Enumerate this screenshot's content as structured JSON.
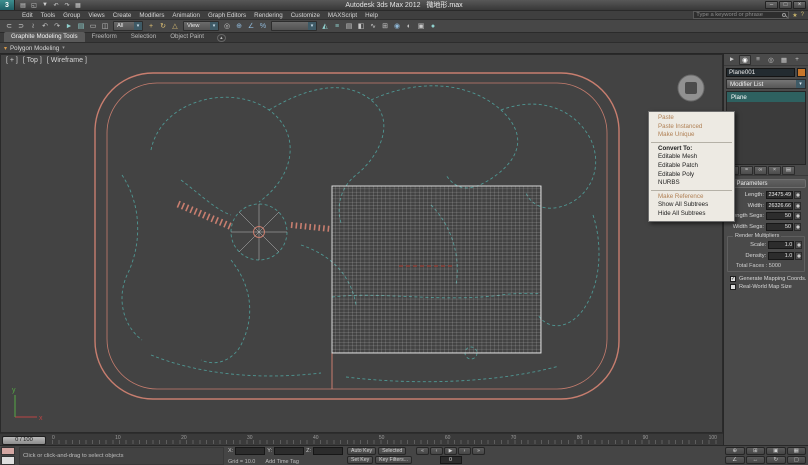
{
  "colors": {
    "salmon": "#c87e6f",
    "teal": "#4f9793",
    "selection": "#2e6160",
    "disabled_item": "#b08055",
    "accent_blue": "#3e5a66",
    "panel": "#4a4a4a"
  },
  "window": {
    "app_title": "Autodesk 3ds Max 2012",
    "doc_title": "微地形.max",
    "minimize": "–",
    "maximize": "□",
    "close": "×"
  },
  "quick_access": [
    {
      "glyph": "▤",
      "name": "new-scene-icon"
    },
    {
      "glyph": "◱",
      "name": "open-file-icon"
    },
    {
      "glyph": "▼",
      "name": "save-file-icon"
    },
    {
      "glyph": "↶",
      "name": "undo-icon"
    },
    {
      "glyph": "↷",
      "name": "redo-icon"
    },
    {
      "glyph": "▦",
      "name": "project-folder-icon"
    }
  ],
  "menubar": {
    "items": [
      {
        "label": "Edit",
        "name": "menu-edit"
      },
      {
        "label": "Tools",
        "name": "menu-tools"
      },
      {
        "label": "Group",
        "name": "menu-group"
      },
      {
        "label": "Views",
        "name": "menu-views"
      },
      {
        "label": "Create",
        "name": "menu-create"
      },
      {
        "label": "Modifiers",
        "name": "menu-modifiers"
      },
      {
        "label": "Animation",
        "name": "menu-animation"
      },
      {
        "label": "Graph Editors",
        "name": "menu-graph-editors"
      },
      {
        "label": "Rendering",
        "name": "menu-rendering"
      },
      {
        "label": "Customize",
        "name": "menu-customize"
      },
      {
        "label": "MAXScript",
        "name": "menu-maxscript"
      },
      {
        "label": "Help",
        "name": "menu-help"
      }
    ],
    "search_placeholder": "Type a keyword or phrase",
    "infocenter_icons": [
      {
        "glyph": "★",
        "name": "favorites-icon"
      },
      {
        "glyph": "?",
        "name": "help-icon"
      }
    ]
  },
  "toolbar": {
    "g1": [
      {
        "glyph": "⊂",
        "tone": "gray",
        "name": "select-and-link-icon"
      },
      {
        "glyph": "⊃",
        "tone": "gray",
        "name": "unlink-selection-icon"
      },
      {
        "glyph": "≀",
        "tone": "gray",
        "name": "bind-to-space-warp-icon"
      },
      {
        "glyph": "↶",
        "tone": "gray",
        "name": "undo-icon"
      },
      {
        "glyph": "↷",
        "tone": "gray",
        "name": "redo-icon"
      },
      {
        "glyph": "►",
        "tone": "teal",
        "name": "select-object-icon"
      },
      {
        "glyph": "▤",
        "tone": "teal",
        "name": "select-by-name-icon"
      },
      {
        "glyph": "▭",
        "tone": "gray",
        "name": "rectangular-selection-region-icon"
      },
      {
        "glyph": "◫",
        "tone": "gray",
        "name": "window-crossing-toggle-icon"
      }
    ],
    "filter_value": "All",
    "g2": [
      {
        "glyph": "+",
        "tone": "yellow",
        "name": "select-and-move-icon"
      },
      {
        "glyph": "↻",
        "tone": "yellow",
        "name": "select-and-rotate-icon"
      },
      {
        "glyph": "△",
        "tone": "yellow",
        "name": "select-and-scale-icon"
      }
    ],
    "refcoord_value": "View",
    "g3": [
      {
        "glyph": "◎",
        "tone": "gray",
        "name": "use-pivot-point-icon"
      },
      {
        "glyph": "⊕",
        "tone": "blue",
        "name": "snaps-toggle-icon"
      },
      {
        "glyph": "∠",
        "tone": "blue",
        "name": "angle-snap-icon"
      },
      {
        "glyph": "%",
        "tone": "blue",
        "name": "percent-snap-icon"
      }
    ],
    "named_sel_value": "",
    "g4": [
      {
        "glyph": "◭",
        "tone": "teal",
        "name": "mirror-icon"
      },
      {
        "glyph": "≡",
        "tone": "teal",
        "name": "align-icon"
      },
      {
        "glyph": "▤",
        "tone": "gray",
        "name": "layer-manager-icon"
      },
      {
        "glyph": "◧",
        "tone": "gray",
        "name": "graphite-ribbon-toggle-icon"
      },
      {
        "glyph": "∿",
        "tone": "gray",
        "name": "curve-editor-icon"
      },
      {
        "glyph": "⊞",
        "tone": "gray",
        "name": "schematic-view-icon"
      },
      {
        "glyph": "◉",
        "tone": "blue",
        "name": "material-editor-icon"
      },
      {
        "glyph": "◐",
        "tone": "gray",
        "name": "render-setup-icon"
      },
      {
        "glyph": "▣",
        "tone": "gray",
        "name": "rendered-frame-window-icon"
      },
      {
        "glyph": "●",
        "tone": "teal",
        "name": "render-production-icon"
      }
    ]
  },
  "ribbon": {
    "tabs": [
      {
        "label": "Graphite Modeling Tools",
        "cls": "active",
        "name": "tab-graphite-modeling-tools"
      },
      {
        "label": "Freeform",
        "name": "tab-freeform"
      },
      {
        "label": "Selection",
        "name": "tab-selection"
      },
      {
        "label": "Object Paint",
        "name": "tab-object-paint"
      }
    ],
    "min_glyph": "▴",
    "subbar_label": "Polygon Modeling",
    "subbar_arrow": "▾",
    "subbar_icon": "▾"
  },
  "viewport": {
    "plus_label": "[ + ]",
    "view_label": "[ Top ]",
    "shading_label": "[ Wireframe ]"
  },
  "context_menu": {
    "items": [
      {
        "label": "Paste",
        "cls": "disabled",
        "name": "menu-item-paste",
        "inter": "false"
      },
      {
        "label": "Paste Instanced",
        "cls": "disabled",
        "name": "menu-item-paste-instanced",
        "inter": "false"
      },
      {
        "label": "Make Unique",
        "cls": "disabled",
        "name": "menu-item-make-unique",
        "inter": "false"
      },
      {
        "cls": "sep",
        "name": "menu-separator",
        "inter": "false"
      },
      {
        "label": "Convert To:",
        "cls": "header",
        "name": "menu-item-convert-to",
        "inter": "false"
      },
      {
        "label": "Editable Mesh",
        "name": "menu-item-editable-mesh",
        "inter": "true"
      },
      {
        "label": "Editable Patch",
        "name": "menu-item-editable-patch",
        "inter": "true"
      },
      {
        "label": "Editable Poly",
        "name": "menu-item-editable-poly",
        "inter": "true"
      },
      {
        "label": "NURBS",
        "name": "menu-item-nurbs",
        "inter": "true"
      },
      {
        "cls": "sep",
        "name": "menu-separator",
        "inter": "false"
      },
      {
        "label": "Make Reference",
        "cls": "disabled",
        "name": "menu-item-make-reference",
        "inter": "false"
      },
      {
        "label": "Show All Subtrees",
        "name": "menu-item-show-all-subtrees",
        "inter": "true"
      },
      {
        "label": "Hide All Subtrees",
        "name": "menu-item-hide-all-subtrees",
        "inter": "true"
      }
    ]
  },
  "command_panel": {
    "tabs": [
      {
        "glyph": "►",
        "name": "create-tab"
      },
      {
        "glyph": "◉",
        "cls": "active",
        "name": "modify-tab"
      },
      {
        "glyph": "≡",
        "name": "hierarchy-tab"
      },
      {
        "glyph": "◎",
        "name": "motion-tab"
      },
      {
        "glyph": "▦",
        "name": "display-tab"
      },
      {
        "glyph": "+",
        "name": "utilities-tab"
      }
    ],
    "object_name": "Plane001",
    "modifier_list_label": "Modifier List",
    "stack": [
      {
        "label": "Plane",
        "cls": "selected",
        "name": "stack-item-plane"
      }
    ],
    "stack_tools": [
      {
        "glyph": "⊙",
        "name": "pin-stack-button"
      },
      {
        "glyph": "≈",
        "name": "show-end-result-button"
      },
      {
        "glyph": "∞",
        "name": "make-unique-button"
      },
      {
        "glyph": "×",
        "name": "remove-modifier-button"
      },
      {
        "glyph": "▤",
        "name": "configure-modifier-sets-button"
      }
    ],
    "parameters": {
      "title": "Parameters",
      "rows": [
        {
          "label": "Length:",
          "value": "23475.49",
          "name": "length-field"
        },
        {
          "label": "Width:",
          "value": "26326.66",
          "name": "width-field"
        },
        {
          "label": "Length Segs:",
          "value": "50",
          "name": "length-segs-field"
        },
        {
          "label": "Width Segs:",
          "value": "50",
          "name": "width-segs-field"
        }
      ],
      "render_mult_title": "Render Multipliers",
      "rm_rows": [
        {
          "label": "Scale:",
          "value": "1.0",
          "name": "scale-field"
        },
        {
          "label": "Density:",
          "value": "1.0",
          "name": "density-field"
        }
      ],
      "total_faces": "Total Faces : 5000",
      "gen_mapping": "Generate Mapping Coords.",
      "real_world": "Real-World Map Size"
    }
  },
  "timeline": {
    "slider_label": "0 / 100",
    "frame_labels": [
      "0",
      "10",
      "20",
      "30",
      "40",
      "50",
      "60",
      "70",
      "80",
      "90",
      "100"
    ]
  },
  "status_bar": {
    "prompt": "Click or click-and-drag to select objects",
    "coords": [
      {
        "label": "X:",
        "value": "",
        "name": "x-coordinate-field"
      },
      {
        "label": "Y:",
        "value": "",
        "name": "y-coordinate-field"
      },
      {
        "label": "Z:",
        "value": "",
        "name": "z-coordinate-field"
      }
    ],
    "grid_label": "Grid = 10.0",
    "time_tag": "Add Time Tag",
    "auto_key": "Auto Key",
    "set_key": "Set Key",
    "selected": "Selected",
    "key_filters": "Key Filters...",
    "frame": "0",
    "transport": [
      {
        "glyph": "«",
        "name": "go-to-start-button"
      },
      {
        "glyph": "‹",
        "name": "previous-frame-button"
      },
      {
        "glyph": "▶",
        "name": "play-button"
      },
      {
        "glyph": "›",
        "name": "next-frame-button"
      },
      {
        "glyph": "»",
        "name": "go-to-end-button"
      }
    ],
    "vnav": [
      {
        "glyph": "⊕",
        "name": "zoom-button"
      },
      {
        "glyph": "⊞",
        "name": "zoom-all-button"
      },
      {
        "glyph": "▣",
        "name": "zoom-extents-button"
      },
      {
        "glyph": "▦",
        "name": "zoom-extents-all-button"
      },
      {
        "glyph": "∠",
        "name": "field-of-view-button"
      },
      {
        "glyph": "↔",
        "name": "pan-view-button"
      },
      {
        "glyph": "↻",
        "name": "orbit-button"
      },
      {
        "glyph": "▢",
        "name": "maximize-viewport-toggle-button"
      }
    ]
  }
}
